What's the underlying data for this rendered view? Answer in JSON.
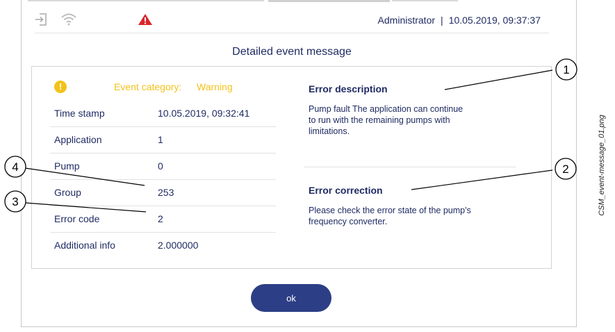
{
  "status_bar": {
    "user": "Administrator",
    "separator": "|",
    "datetime": "10.05.2019, 09:37:37",
    "icons": [
      "login-icon",
      "wifi-icon",
      "alert-triangle-icon"
    ]
  },
  "dialog": {
    "title": "Detailed event message",
    "category_label": "Event category:",
    "category_value": "Warning",
    "rows": [
      {
        "key": "Time stamp",
        "value": "10.05.2019, 09:32:41"
      },
      {
        "key": "Application",
        "value": "1"
      },
      {
        "key": "Pump",
        "value": "0"
      },
      {
        "key": "Group",
        "value": "253"
      },
      {
        "key": "Error code",
        "value": "2"
      },
      {
        "key": "Additional info",
        "value": "2.000000"
      }
    ],
    "error_description": {
      "heading": "Error description",
      "text_lines": [
        "Pump fault The application can continue",
        "to run with the remaining pumps with",
        "limitations."
      ]
    },
    "error_correction": {
      "heading": "Error correction",
      "text_lines": [
        "Please check the error state of the pump's",
        "frequency converter."
      ]
    },
    "ok_label": "ok"
  },
  "callouts": [
    "1",
    "2",
    "3",
    "4"
  ],
  "side_caption": "CSM_event-message_01.png",
  "colors": {
    "text": "#1f2b63",
    "warning": "#f3c21a",
    "alert": "#d9262c",
    "button": "#2c3e85"
  }
}
